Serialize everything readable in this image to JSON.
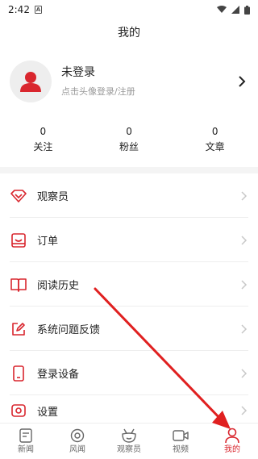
{
  "status_bar": {
    "time": "2:42"
  },
  "header": {
    "title": "我的"
  },
  "profile": {
    "name": "未登录",
    "hint": "点击头像登录/注册"
  },
  "stats": [
    {
      "value": "0",
      "label": "关注"
    },
    {
      "value": "0",
      "label": "粉丝"
    },
    {
      "value": "0",
      "label": "文章"
    }
  ],
  "menu": [
    {
      "label": "观察员",
      "icon": "diamond-icon"
    },
    {
      "label": "订单",
      "icon": "order-tray-icon"
    },
    {
      "label": "阅读历史",
      "icon": "open-book-icon"
    },
    {
      "label": "系统问题反馈",
      "icon": "edit-feedback-icon"
    },
    {
      "label": "登录设备",
      "icon": "phone-device-icon"
    },
    {
      "label": "设置",
      "icon": "settings-icon"
    }
  ],
  "tabbar": [
    {
      "label": "新闻",
      "icon": "news-icon",
      "active": false
    },
    {
      "label": "风闻",
      "icon": "wind-news-icon",
      "active": false
    },
    {
      "label": "观察员",
      "icon": "observer-icon",
      "active": false
    },
    {
      "label": "视频",
      "icon": "video-icon",
      "active": false
    },
    {
      "label": "我的",
      "icon": "person-icon",
      "active": true
    }
  ],
  "colors": {
    "accent": "#d9262e",
    "text": "#222222",
    "muted": "#999999",
    "band": "#f4f4f4"
  }
}
